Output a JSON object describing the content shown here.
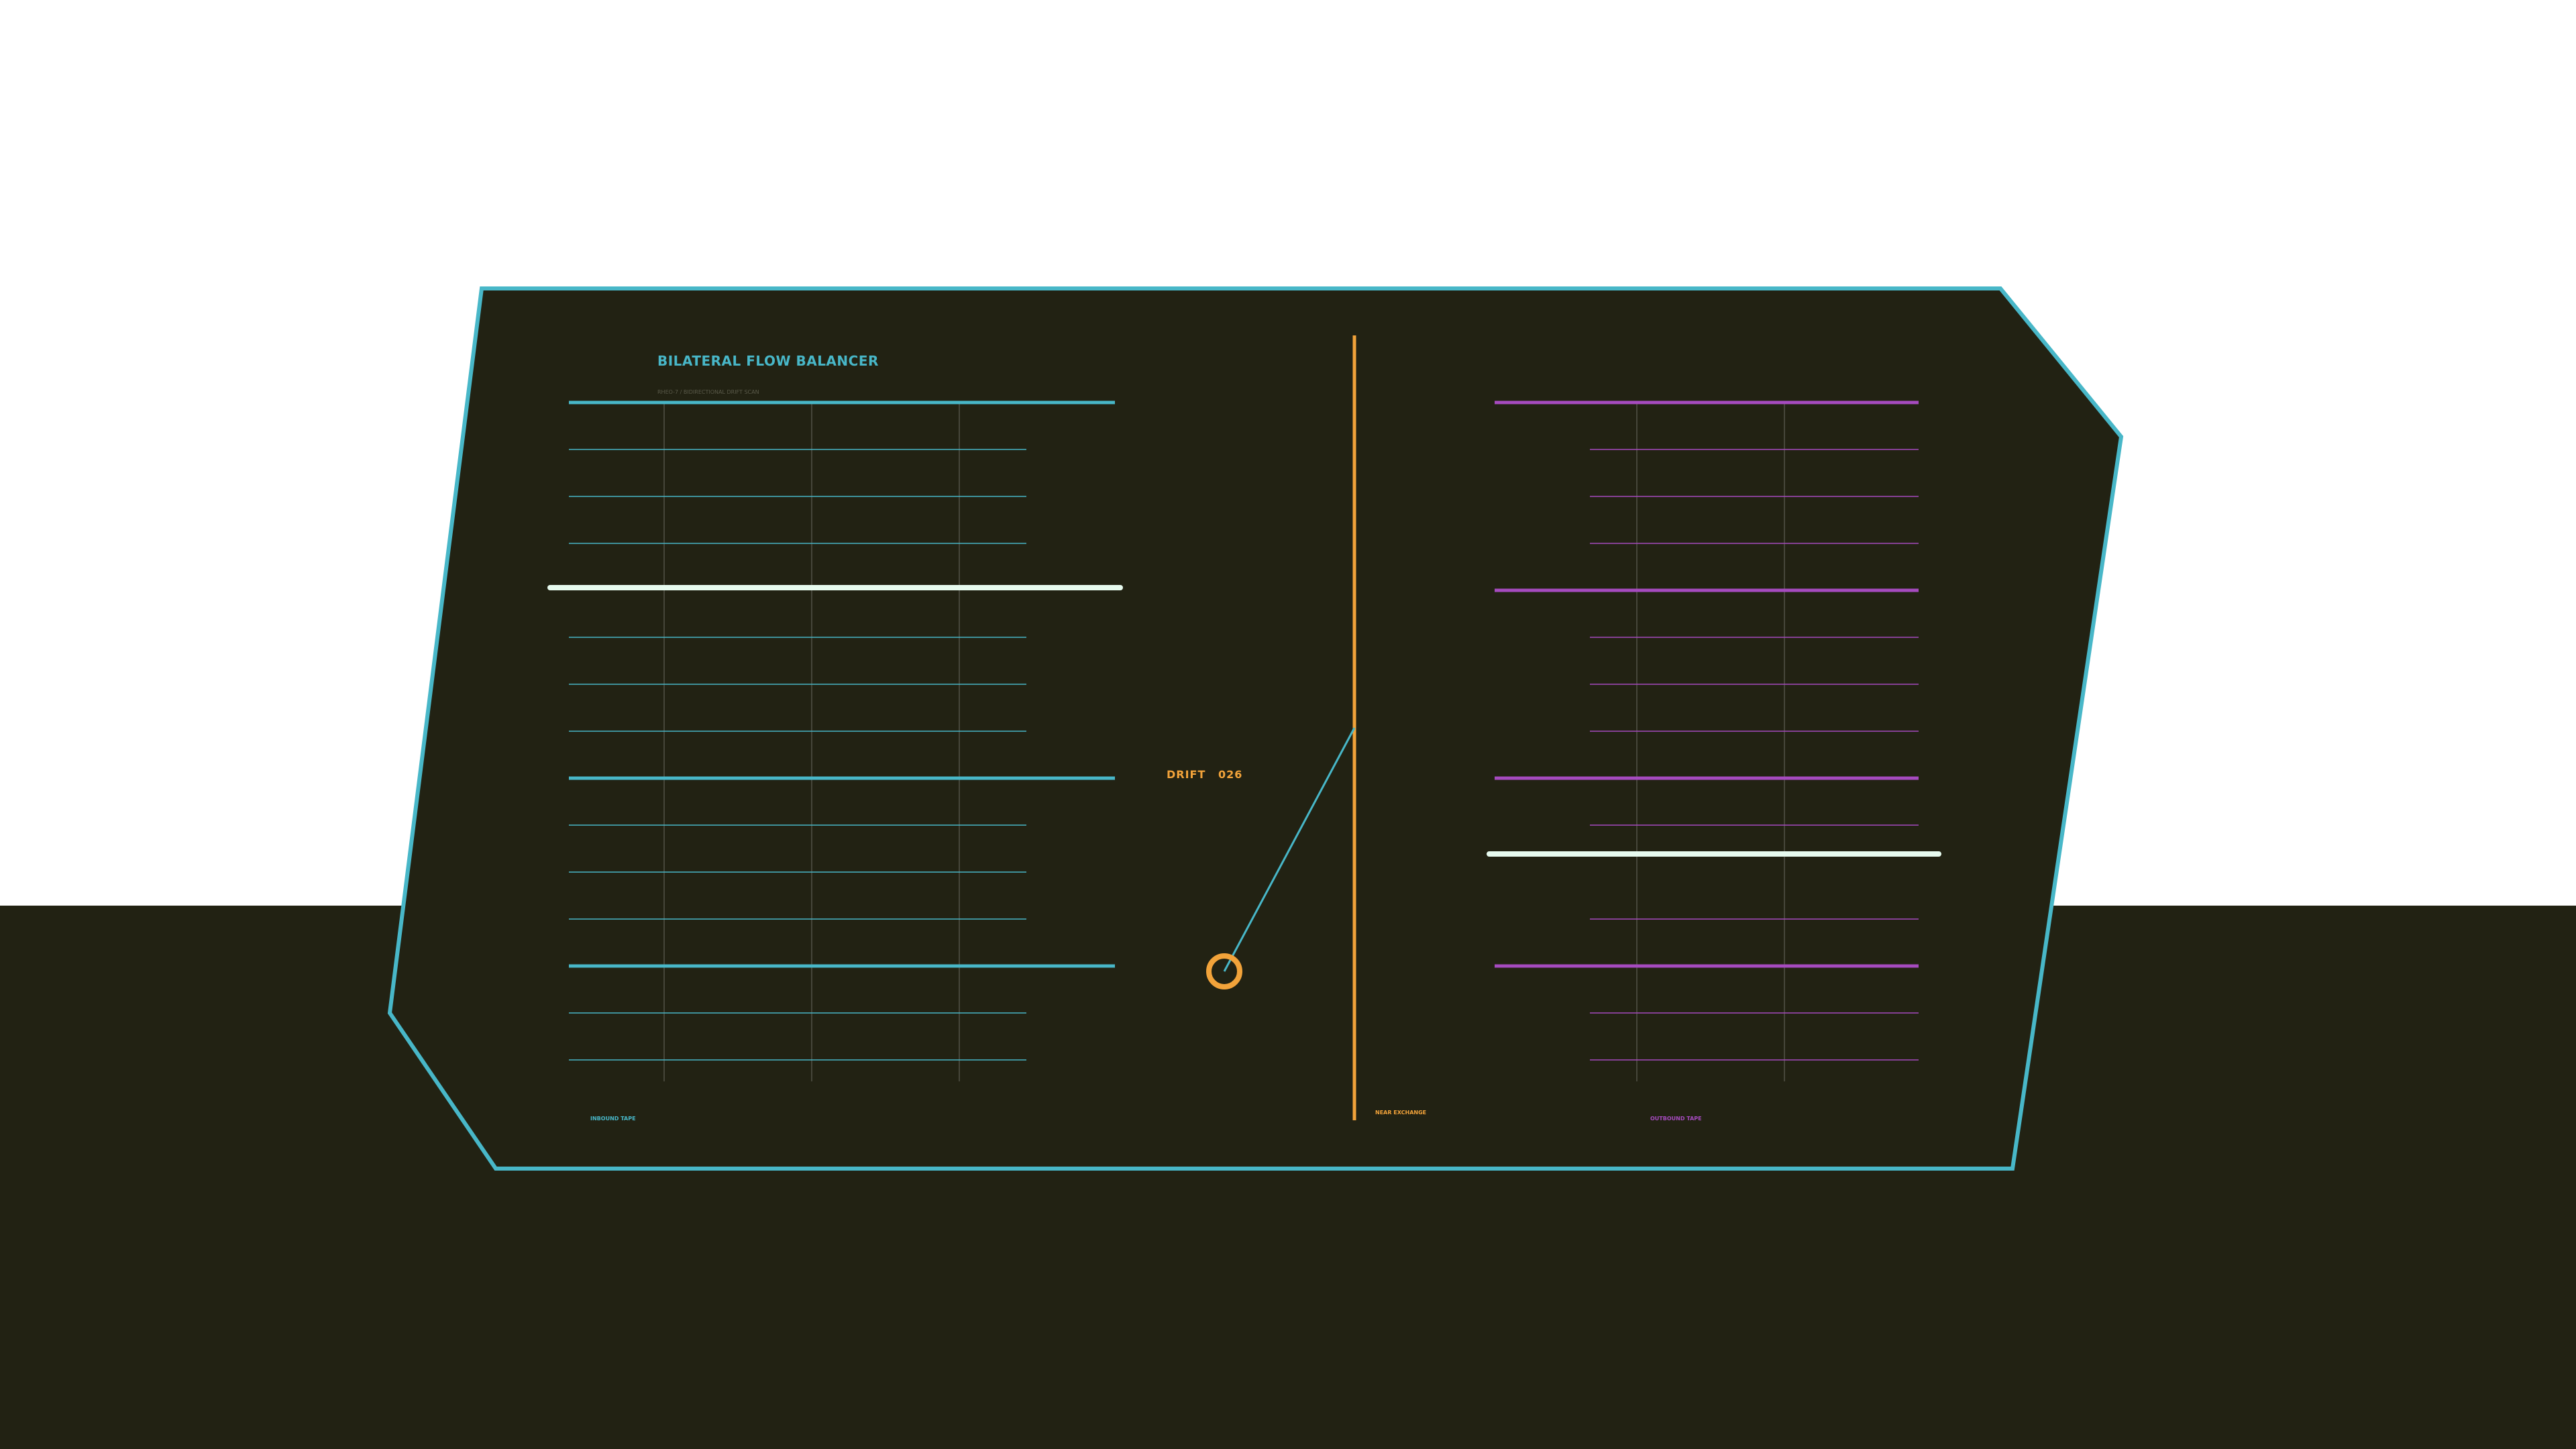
{
  "panel": {
    "title": "BILATERAL FLOW BALANCER",
    "subtitle": "RHEO-7 / BIDIRECTIONAL DRIFT SCAN",
    "drift_label": "DRIFT",
    "drift_value": "026",
    "left_caption": "INBOUND TAPE",
    "center_caption": "NEAR EXCHANGE",
    "right_caption": "OUTBOUND TAPE"
  },
  "colors": {
    "background": "#222213",
    "panel_fill": "#222213",
    "frame": "#48b7c8",
    "inbound": "#48b7c8",
    "outbound": "#a64bbf",
    "exchange": "#f2a33a",
    "marker": "#e7fbef",
    "grid": "#5a5a4a"
  },
  "tapes": {
    "inbound": {
      "major_count": 4,
      "minor_between": 3,
      "marker_index": 4
    },
    "outbound": {
      "major_count": 4,
      "minor_between": 3,
      "marker_index": 10
    }
  }
}
